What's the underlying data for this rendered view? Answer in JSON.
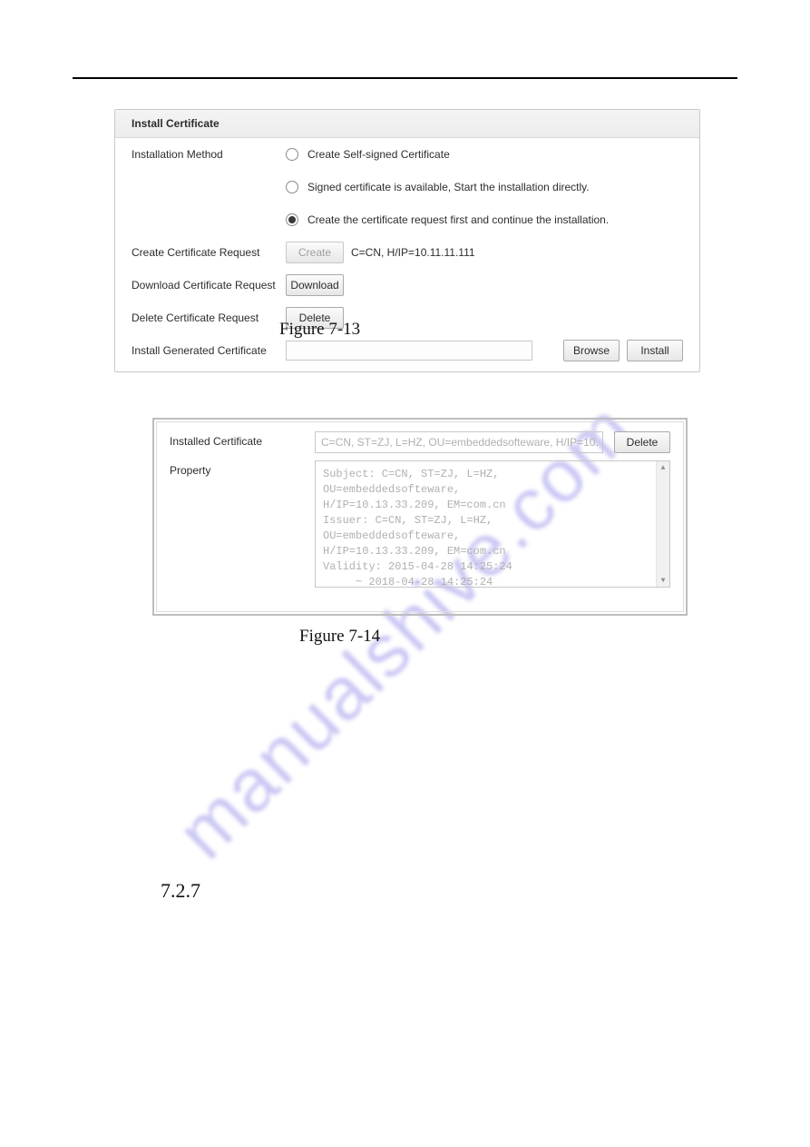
{
  "figure713": {
    "title": "Install Certificate",
    "rows": {
      "method_label": "Installation Method",
      "radio1": "Create Self-signed Certificate",
      "radio2": "Signed certificate is available, Start the installation directly.",
      "radio3": "Create the certificate request first and continue the installation.",
      "create_label": "Create Certificate Request",
      "create_btn": "Create",
      "create_value": "C=CN, H/IP=10.11.11.111",
      "download_label": "Download Certificate Request",
      "download_btn": "Download",
      "delete_label": "Delete Certificate Request",
      "delete_btn": "Delete",
      "install_label": "Install Generated Certificate",
      "browse_btn": "Browse",
      "install_btn": "Install"
    },
    "caption": "Figure 7-13"
  },
  "figure714": {
    "installed_label": "Installed Certificate",
    "installed_value": "C=CN, ST=ZJ, L=HZ, OU=embeddedsofteware, H/IP=10.",
    "delete_btn": "Delete",
    "property_label": "Property",
    "property_text": "Subject: C=CN, ST=ZJ, L=HZ,\nOU=embeddedsofteware,\nH/IP=10.13.33.209, EM=com.cn\nIssuer: C=CN, ST=ZJ, L=HZ,\nOU=embeddedsofteware,\nH/IP=10.13.33.209, EM=com.cn\nValidity: 2015-04-28 14:25:24\n     ~ 2018-04-28 14:25:24",
    "caption": "Figure 7-14"
  },
  "watermark": "manualshive.com",
  "section_number": "7.2.7"
}
